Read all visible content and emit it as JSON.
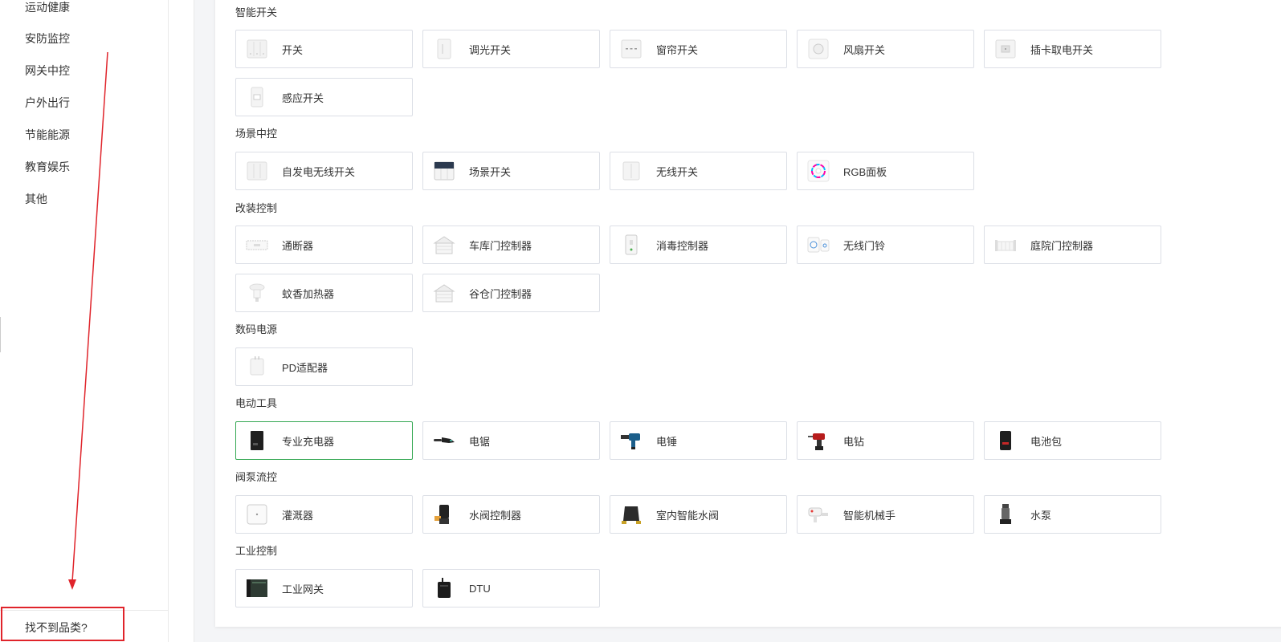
{
  "sidebar": {
    "items": [
      {
        "label": "运动健康"
      },
      {
        "label": "安防监控"
      },
      {
        "label": "网关中控"
      },
      {
        "label": "户外出行"
      },
      {
        "label": "节能能源"
      },
      {
        "label": "教育娱乐"
      },
      {
        "label": "其他"
      }
    ],
    "bottom_link": "找不到品类?"
  },
  "colors": {
    "annotation_red": "#e0242b",
    "selected_green": "#35a853",
    "card_border": "#dcdfe6"
  },
  "sections": [
    {
      "title": "智能开关",
      "items": [
        {
          "label": "开关",
          "icon": "switch-3gang-icon"
        },
        {
          "label": "调光开关",
          "icon": "dimmer-switch-icon"
        },
        {
          "label": "窗帘开关",
          "icon": "curtain-switch-icon"
        },
        {
          "label": "风扇开关",
          "icon": "fan-switch-icon"
        },
        {
          "label": "插卡取电开关",
          "icon": "card-power-switch-icon"
        },
        {
          "label": "感应开关",
          "icon": "sensor-switch-icon"
        }
      ]
    },
    {
      "title": "场景中控",
      "items": [
        {
          "label": "自发电无线开关",
          "icon": "self-powered-switch-icon"
        },
        {
          "label": "场景开关",
          "icon": "scene-switch-icon"
        },
        {
          "label": "无线开关",
          "icon": "wireless-switch-icon"
        },
        {
          "label": "RGB面板",
          "icon": "rgb-panel-icon"
        }
      ]
    },
    {
      "title": "改装控制",
      "items": [
        {
          "label": "通断器",
          "icon": "breaker-module-icon"
        },
        {
          "label": "车库门控制器",
          "icon": "garage-door-icon"
        },
        {
          "label": "消毒控制器",
          "icon": "disinfection-controller-icon"
        },
        {
          "label": "无线门铃",
          "icon": "doorbell-icon"
        },
        {
          "label": "庭院门控制器",
          "icon": "yard-gate-icon"
        },
        {
          "label": "蚊香加热器",
          "icon": "mosquito-heater-icon"
        },
        {
          "label": "谷仓门控制器",
          "icon": "barn-door-icon"
        }
      ]
    },
    {
      "title": "数码电源",
      "items": [
        {
          "label": "PD适配器",
          "icon": "pd-adapter-icon"
        }
      ]
    },
    {
      "title": "电动工具",
      "items": [
        {
          "label": "专业充电器",
          "icon": "charger-icon",
          "selected": true
        },
        {
          "label": "电锯",
          "icon": "chainsaw-icon"
        },
        {
          "label": "电锤",
          "icon": "hammer-drill-icon"
        },
        {
          "label": "电钻",
          "icon": "drill-icon"
        },
        {
          "label": "电池包",
          "icon": "battery-pack-icon"
        }
      ]
    },
    {
      "title": "阀泵流控",
      "items": [
        {
          "label": "灌溉器",
          "icon": "irrigator-icon"
        },
        {
          "label": "水阀控制器",
          "icon": "water-valve-icon"
        },
        {
          "label": "室内智能水阀",
          "icon": "indoor-valve-icon"
        },
        {
          "label": "智能机械手",
          "icon": "robot-arm-icon"
        },
        {
          "label": "水泵",
          "icon": "water-pump-icon"
        }
      ]
    },
    {
      "title": "工业控制",
      "items": [
        {
          "label": "工业网关",
          "icon": "industrial-gateway-icon"
        },
        {
          "label": "DTU",
          "icon": "dtu-icon"
        }
      ]
    }
  ]
}
